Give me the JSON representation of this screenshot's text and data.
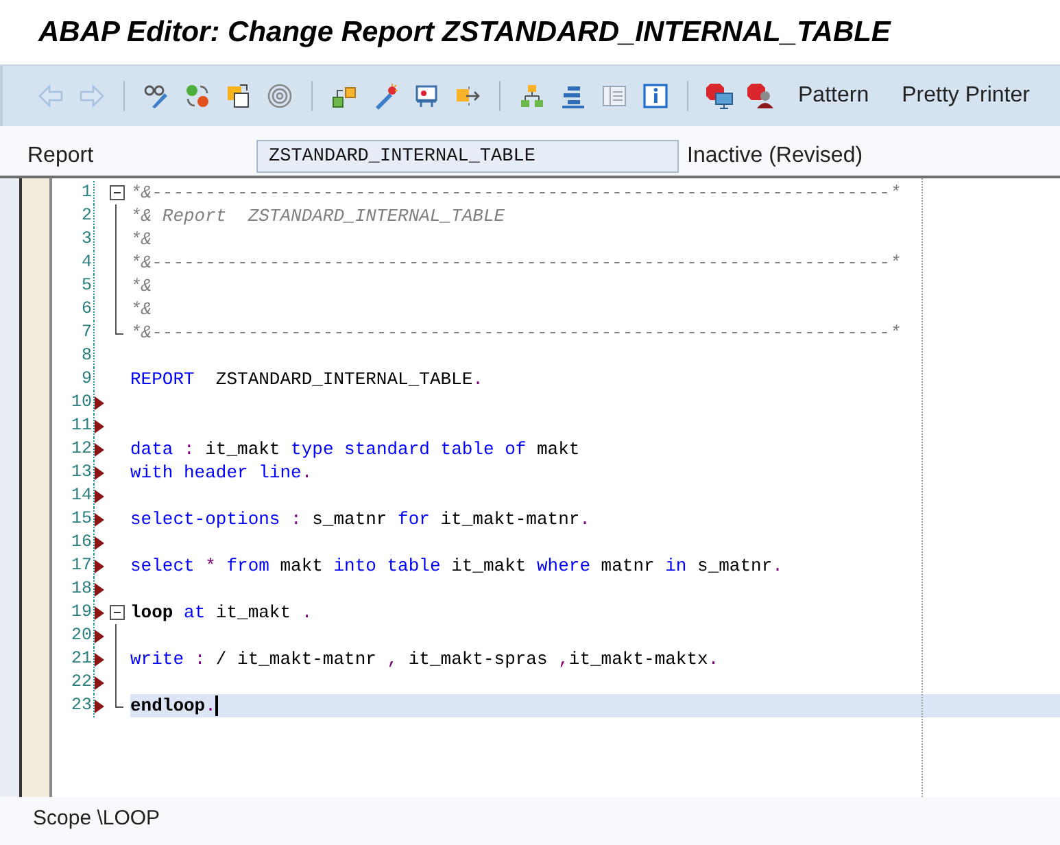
{
  "window": {
    "title": "ABAP Editor: Change Report ZSTANDARD_INTERNAL_TABLE"
  },
  "toolbar": {
    "nav_buttons": [
      {
        "disabled": true
      },
      {
        "disabled": true
      }
    ],
    "text_buttons": [
      "Pattern",
      "Pretty Printer"
    ]
  },
  "report": {
    "label": "Report",
    "value": "ZSTANDARD_INTERNAL_TABLE",
    "status": "Inactive (Revised)"
  },
  "lines": [
    {
      "number": "1",
      "changed": false,
      "kind": "block_start",
      "current": false,
      "tokens": [
        {
          "kind": "comment",
          "text": "*&---------------------------------------------------------------------*"
        }
      ]
    },
    {
      "number": "2",
      "changed": false,
      "kind": "block_body",
      "current": false,
      "tokens": [
        {
          "kind": "comment",
          "text": "*& Report  ZSTANDARD_INTERNAL_TABLE"
        }
      ]
    },
    {
      "number": "3",
      "changed": false,
      "kind": "block_body",
      "current": false,
      "tokens": [
        {
          "kind": "comment",
          "text": "*&"
        }
      ]
    },
    {
      "number": "4",
      "changed": false,
      "kind": "block_body",
      "current": false,
      "tokens": [
        {
          "kind": "comment",
          "text": "*&---------------------------------------------------------------------*"
        }
      ]
    },
    {
      "number": "5",
      "changed": false,
      "kind": "block_body",
      "current": false,
      "tokens": [
        {
          "kind": "comment",
          "text": "*&"
        }
      ]
    },
    {
      "number": "6",
      "changed": false,
      "kind": "block_body",
      "current": false,
      "tokens": [
        {
          "kind": "comment",
          "text": "*&"
        }
      ]
    },
    {
      "number": "7",
      "changed": false,
      "kind": "block_end",
      "current": false,
      "tokens": [
        {
          "kind": "comment",
          "text": "*&---------------------------------------------------------------------*"
        }
      ]
    },
    {
      "number": "8",
      "changed": false,
      "kind": "plain",
      "current": false
    },
    {
      "number": "9",
      "changed": false,
      "kind": "plain",
      "current": false,
      "tokens": [
        {
          "kind": "keyword",
          "text": "REPORT"
        },
        {
          "kind": "text",
          "text": "  ZSTANDARD_INTERNAL_TABLE"
        },
        {
          "kind": "punct",
          "text": "."
        }
      ]
    },
    {
      "number": "10",
      "changed": true,
      "kind": "plain",
      "current": false
    },
    {
      "number": "11",
      "changed": true,
      "kind": "plain",
      "current": false
    },
    {
      "number": "12",
      "changed": true,
      "kind": "plain",
      "current": false,
      "tokens": [
        {
          "kind": "keyword",
          "text": "data"
        },
        {
          "kind": "punct",
          "text": " : "
        },
        {
          "kind": "text",
          "text": "it_makt "
        },
        {
          "kind": "keyword",
          "text": "type standard table of"
        },
        {
          "kind": "text",
          "text": " makt"
        }
      ]
    },
    {
      "number": "13",
      "changed": true,
      "kind": "plain",
      "current": false,
      "tokens": [
        {
          "kind": "keyword",
          "text": "with header line"
        },
        {
          "kind": "punct",
          "text": "."
        }
      ]
    },
    {
      "number": "14",
      "changed": true,
      "kind": "plain",
      "current": false
    },
    {
      "number": "15",
      "changed": true,
      "kind": "plain",
      "current": false,
      "tokens": [
        {
          "kind": "keyword",
          "text": "select-options"
        },
        {
          "kind": "punct",
          "text": " : "
        },
        {
          "kind": "text",
          "text": "s_matnr "
        },
        {
          "kind": "keyword",
          "text": "for"
        },
        {
          "kind": "text",
          "text": " it_makt-matnr"
        },
        {
          "kind": "punct",
          "text": "."
        }
      ]
    },
    {
      "number": "16",
      "changed": true,
      "kind": "plain",
      "current": false
    },
    {
      "number": "17",
      "changed": true,
      "kind": "plain",
      "current": false,
      "tokens": [
        {
          "kind": "keyword",
          "text": "select"
        },
        {
          "kind": "punct",
          "text": " * "
        },
        {
          "kind": "keyword",
          "text": "from"
        },
        {
          "kind": "text",
          "text": " makt "
        },
        {
          "kind": "keyword",
          "text": "into table"
        },
        {
          "kind": "text",
          "text": " it_makt "
        },
        {
          "kind": "keyword",
          "text": "where"
        },
        {
          "kind": "text",
          "text": " matnr "
        },
        {
          "kind": "keyword",
          "text": "in"
        },
        {
          "kind": "text",
          "text": " s_matnr"
        },
        {
          "kind": "punct",
          "text": "."
        }
      ]
    },
    {
      "number": "18",
      "changed": true,
      "kind": "plain",
      "current": false
    },
    {
      "number": "19",
      "changed": true,
      "kind": "block_start",
      "current": false,
      "tokens": [
        {
          "kind": "strong",
          "text": "loop"
        },
        {
          "kind": "keyword",
          "text": " at"
        },
        {
          "kind": "text",
          "text": " it_makt "
        },
        {
          "kind": "punct",
          "text": "."
        }
      ]
    },
    {
      "number": "20",
      "changed": true,
      "kind": "block_body",
      "current": false
    },
    {
      "number": "21",
      "changed": true,
      "kind": "block_body",
      "current": false,
      "tokens": [
        {
          "kind": "keyword",
          "text": "write"
        },
        {
          "kind": "punct",
          "text": " : "
        },
        {
          "kind": "text",
          "text": "/ it_makt-matnr "
        },
        {
          "kind": "punct",
          "text": ","
        },
        {
          "kind": "text",
          "text": " it_makt-spras "
        },
        {
          "kind": "punct",
          "text": ","
        },
        {
          "kind": "text",
          "text": "it_makt-maktx"
        },
        {
          "kind": "punct",
          "text": "."
        }
      ]
    },
    {
      "number": "22",
      "changed": true,
      "kind": "block_body",
      "current": false
    },
    {
      "number": "23",
      "changed": true,
      "kind": "block_end",
      "current": true,
      "tokens": [
        {
          "kind": "strong",
          "text": "endloop"
        },
        {
          "kind": "punct",
          "text": "."
        }
      ]
    }
  ],
  "status_bar": {
    "text": "Scope \\LOOP"
  }
}
